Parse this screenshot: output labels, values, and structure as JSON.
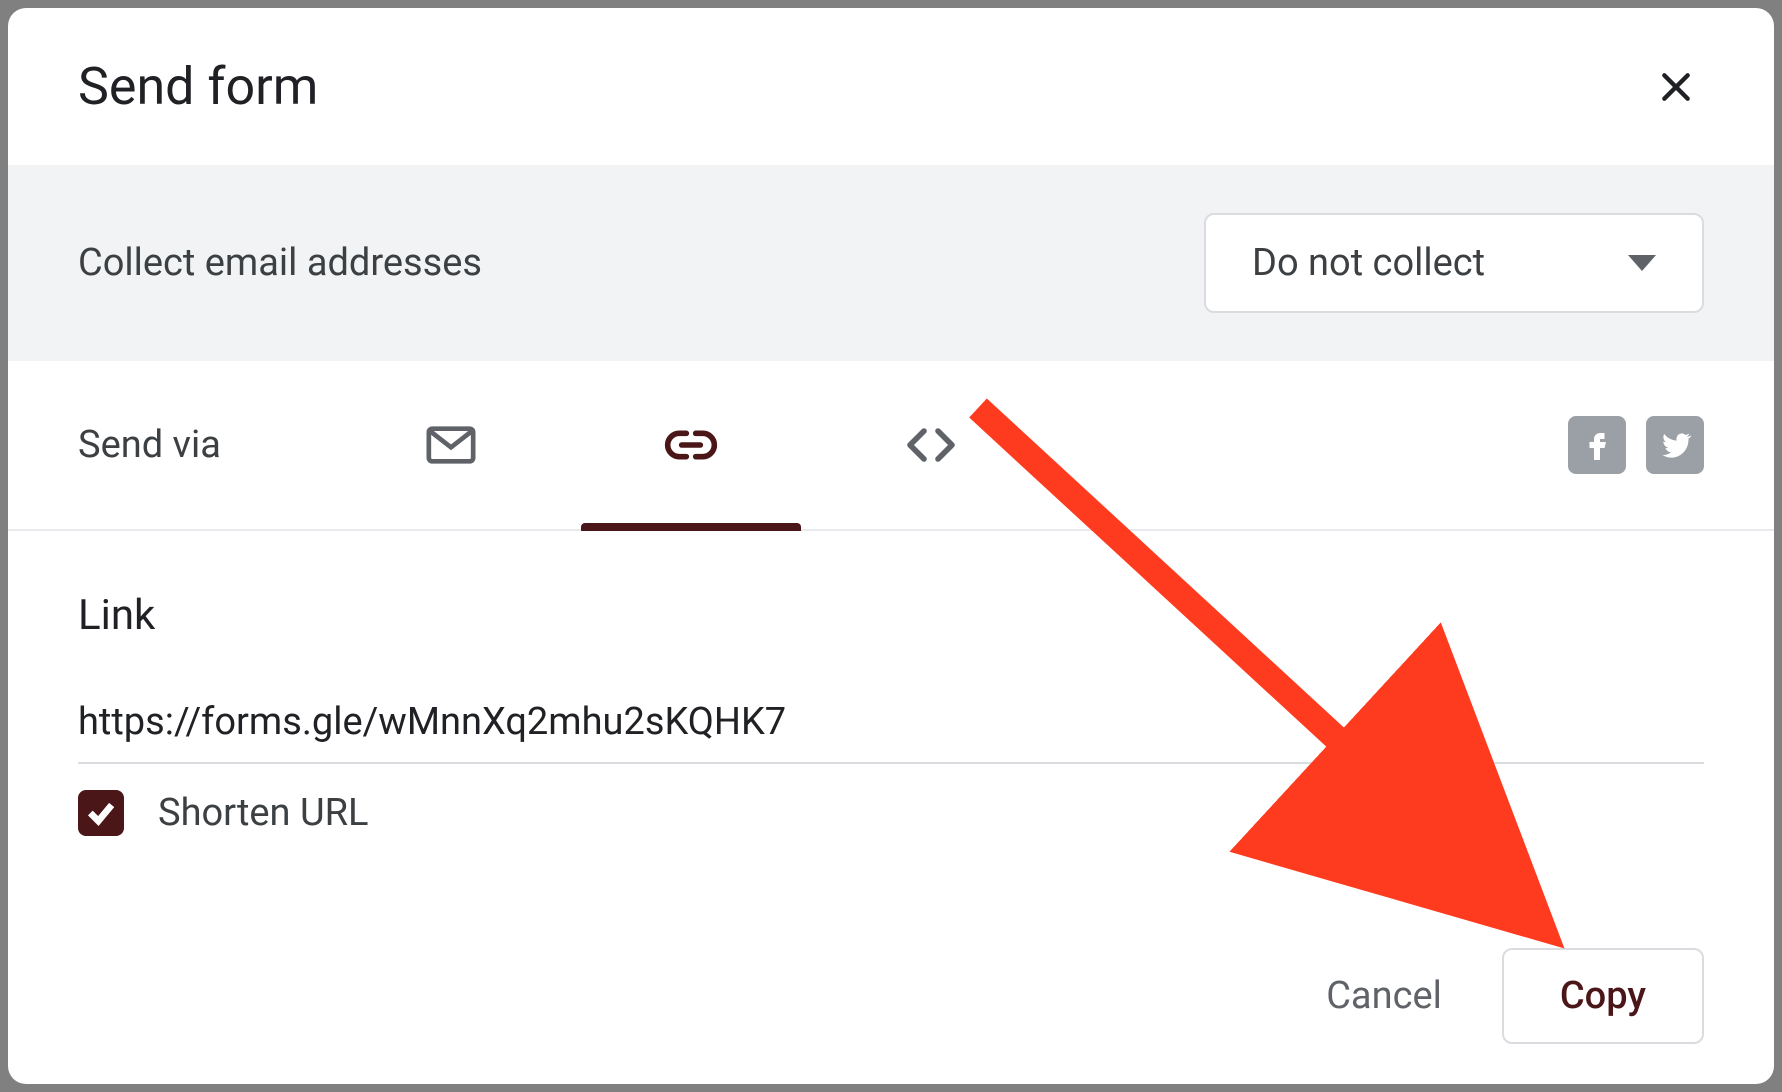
{
  "dialog": {
    "title": "Send form"
  },
  "collect": {
    "label": "Collect email addresses",
    "selected": "Do not collect"
  },
  "sendvia": {
    "label": "Send via"
  },
  "link": {
    "heading": "Link",
    "url": "https://forms.gle/wMnnXq2mhu2sKQHK7",
    "shorten_label": "Shorten URL",
    "shorten_checked": true
  },
  "footer": {
    "cancel": "Cancel",
    "copy": "Copy"
  },
  "colors": {
    "accent": "#4a1617",
    "annotation": "#ff3b1f"
  }
}
